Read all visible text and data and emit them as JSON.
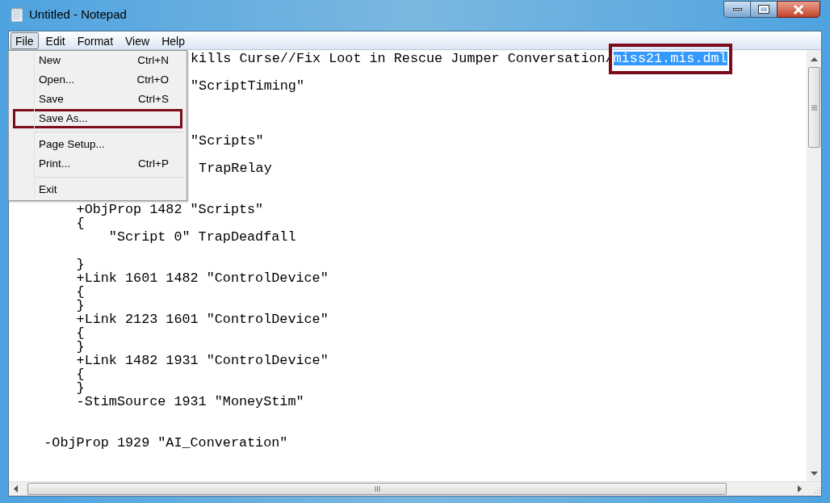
{
  "window": {
    "title": "Untitled - Notepad"
  },
  "menu_bar": [
    {
      "label": "File",
      "selected": true
    },
    {
      "label": "Edit",
      "selected": false
    },
    {
      "label": "Format",
      "selected": false
    },
    {
      "label": "View",
      "selected": false
    },
    {
      "label": "Help",
      "selected": false
    }
  ],
  "file_menu": [
    {
      "kind": "item",
      "label": "New",
      "shortcut": "Ctrl+N",
      "highlighted": false
    },
    {
      "kind": "item",
      "label": "Open...",
      "shortcut": "Ctrl+O",
      "highlighted": false
    },
    {
      "kind": "item",
      "label": "Save",
      "shortcut": "Ctrl+S",
      "highlighted": false
    },
    {
      "kind": "item",
      "label": "Save As...",
      "highlighted": true
    },
    {
      "kind": "separator"
    },
    {
      "kind": "item",
      "label": "Page Setup...",
      "highlighted": false
    },
    {
      "kind": "item",
      "label": "Print...",
      "shortcut": "Ctrl+P",
      "highlighted": false
    },
    {
      "kind": "separator"
    },
    {
      "kind": "item",
      "label": "Exit",
      "highlighted": false
    }
  ],
  "editor_lines": [
    {
      "kind": "partial",
      "text": "kills Curse//Fix Loot in Rescue Jumper Conversation/",
      "selection": "miss21.mis.dml",
      "annotated": true
    },
    {
      "kind": "blank"
    },
    {
      "kind": "partial",
      "text": "\"ScriptTiming\""
    },
    {
      "kind": "blank"
    },
    {
      "kind": "blank"
    },
    {
      "kind": "blank"
    },
    {
      "kind": "partial",
      "text": "\"Scripts\""
    },
    {
      "kind": "blank"
    },
    {
      "kind": "partial",
      "text": " TrapRelay"
    },
    {
      "kind": "blank"
    },
    {
      "kind": "blank"
    },
    {
      "kind": "full",
      "text": "        +ObjProp 1482 \"Scripts\""
    },
    {
      "kind": "full",
      "text": "        {"
    },
    {
      "kind": "full",
      "text": "            \"Script 0\" TrapDeadfall"
    },
    {
      "kind": "blank"
    },
    {
      "kind": "full",
      "text": "        }"
    },
    {
      "kind": "full",
      "text": "        +Link 1601 1482 \"ControlDevice\""
    },
    {
      "kind": "full",
      "text": "        {"
    },
    {
      "kind": "full",
      "text": "        }"
    },
    {
      "kind": "full",
      "text": "        +Link 2123 1601 \"ControlDevice\""
    },
    {
      "kind": "full",
      "text": "        {"
    },
    {
      "kind": "full",
      "text": "        }"
    },
    {
      "kind": "full",
      "text": "        +Link 1482 1931 \"ControlDevice\""
    },
    {
      "kind": "full",
      "text": "        {"
    },
    {
      "kind": "full",
      "text": "        }"
    },
    {
      "kind": "full",
      "text": "        -StimSource 1931 \"MoneyStim\""
    },
    {
      "kind": "blank"
    },
    {
      "kind": "blank"
    },
    {
      "kind": "full",
      "text": "    -ObjProp 1929 \"AI_Converation\""
    }
  ]
}
